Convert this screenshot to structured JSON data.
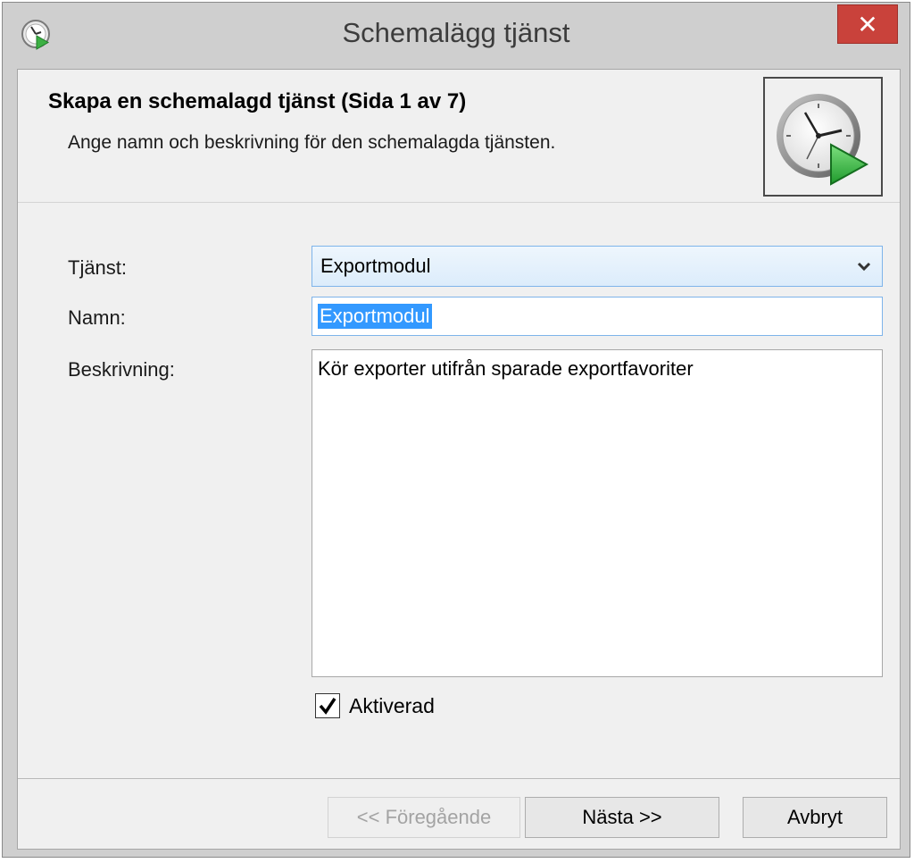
{
  "window": {
    "title": "Schemalägg tjänst",
    "close_glyph": "✕"
  },
  "header": {
    "title": "Skapa en schemalagd tjänst (Sida 1 av 7)",
    "subtitle": "Ange namn och beskrivning för den schemalagda tjänsten.",
    "icon": "clock-play-icon"
  },
  "form": {
    "service_label": "Tjänst:",
    "service_value": "Exportmodul",
    "name_label": "Namn:",
    "name_value": "Exportmodul",
    "description_label": "Beskrivning:",
    "description_value": "Kör exporter utifrån sparade exportfavoriter",
    "enabled_label": "Aktiverad",
    "enabled_checked": true
  },
  "buttons": {
    "previous": "<< Föregående",
    "next": "Nästa >>",
    "cancel": "Avbryt"
  },
  "colors": {
    "close_button": "#c9423b",
    "selection": "#3399ff",
    "play_green": "#3cb043"
  }
}
